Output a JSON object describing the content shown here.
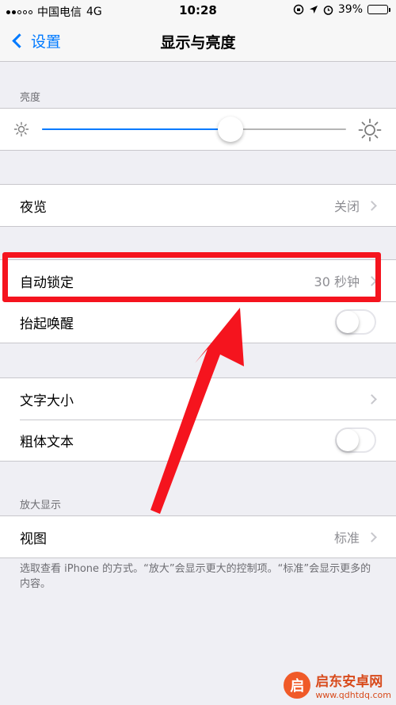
{
  "status_bar": {
    "carrier": "中国电信",
    "network": "4G",
    "time": "10:28",
    "battery_percent": "39%",
    "battery_level": 0.39
  },
  "nav": {
    "back_label": "设置",
    "title": "显示与亮度"
  },
  "brightness": {
    "header": "亮度",
    "level": 0.62
  },
  "night_shift": {
    "label": "夜览",
    "value": "关闭"
  },
  "lock_group": {
    "auto_lock_label": "自动锁定",
    "auto_lock_value": "30 秒钟",
    "raise_to_wake_label": "抬起唤醒",
    "raise_to_wake_on": false
  },
  "text_group": {
    "text_size_label": "文字大小",
    "bold_text_label": "粗体文本",
    "bold_text_on": false
  },
  "zoom": {
    "header": "放大显示",
    "view_label": "视图",
    "view_value": "标准",
    "footer": "选取查看 iPhone 的方式。“放大”会显示更大的控制项。“标准”会显示更多的内容。"
  },
  "watermark": {
    "logo_char": "启",
    "name": "启东安卓网",
    "url": "www.qdhtdq.com"
  },
  "colors": {
    "accent": "#007aff",
    "annotation": "#f5141e",
    "background": "#efeff4"
  }
}
